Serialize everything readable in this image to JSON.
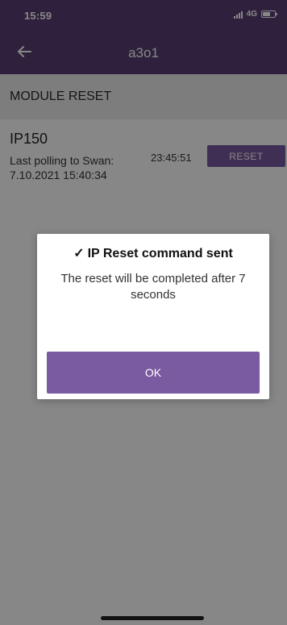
{
  "status_bar": {
    "time": "15:59",
    "network": "4G"
  },
  "app_bar": {
    "back_icon": "back-arrow-icon",
    "title": "a3o1"
  },
  "section": {
    "title": "MODULE RESET"
  },
  "module": {
    "name": "IP150",
    "polling_label": "Last polling to Swan:",
    "polling_date": "7.10.2021 15:40:34",
    "polling_time": "23:45:51",
    "reset_label": "RESET"
  },
  "dialog": {
    "check_icon": "✓",
    "title": "IP Reset command sent",
    "message": "The reset will be completed after 7 seconds",
    "ok_label": "OK"
  },
  "colors": {
    "accent": "#7a5aa0",
    "appbar": "#5a3f73"
  }
}
